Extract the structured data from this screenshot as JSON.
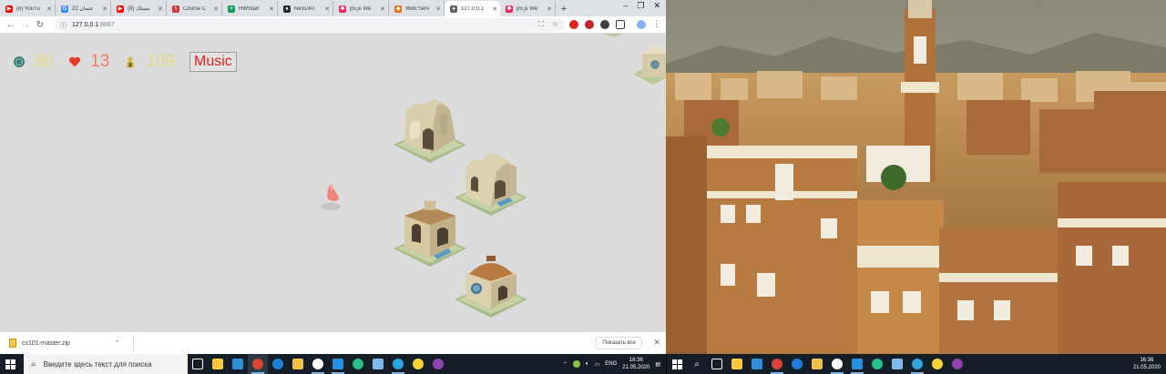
{
  "browser": {
    "tabs": [
      {
        "title": "(8) YouTu",
        "favicon_color": "#ff0000",
        "favicon_glyph": "▶"
      },
      {
        "title": "عثمان 22",
        "favicon_color": "#4285f4",
        "favicon_glyph": "G"
      },
      {
        "title": "(8) مسلك",
        "favicon_color": "#ff0000",
        "favicon_glyph": "▶"
      },
      {
        "title": "Course C",
        "favicon_color": "#d0393e",
        "favicon_glyph": "\\"
      },
      {
        "title": "HWStart",
        "favicon_color": "#0f9d58",
        "favicon_glyph": "+"
      },
      {
        "title": "Ne314/c",
        "favicon_color": "#24292e",
        "favicon_glyph": "●"
      },
      {
        "title": "p5.js We",
        "favicon_color": "#ed225d",
        "favicon_glyph": "✱"
      },
      {
        "title": "Web Serv",
        "favicon_color": "#e8710a",
        "favicon_glyph": "◆"
      },
      {
        "title": "127.0.0.1",
        "favicon_color": "#5f6368",
        "favicon_glyph": "●",
        "active": true
      },
      {
        "title": "p5.js We",
        "favicon_color": "#ed225d",
        "favicon_glyph": "✱"
      }
    ],
    "url_host": "127.0.0.1",
    "url_port": ":8887"
  },
  "game": {
    "hud": {
      "coins": "96",
      "hearts": "13",
      "population": "109",
      "music_label": "Music"
    },
    "colors": {
      "coins_text": "#e7d98a",
      "hearts_text": "#ef7a66",
      "population_text": "#e7d98a",
      "music_text": "#e0201c"
    }
  },
  "downloads": {
    "filename": "cs101-master.zip",
    "show_all_label": "Показать все"
  },
  "taskbar": {
    "search_placeholder": "Введите здесь текст для поиска",
    "language": "ENG",
    "time": "16:36",
    "date": "21.05.2020",
    "time_right": "16:36",
    "date_right": "21.05.2020"
  }
}
